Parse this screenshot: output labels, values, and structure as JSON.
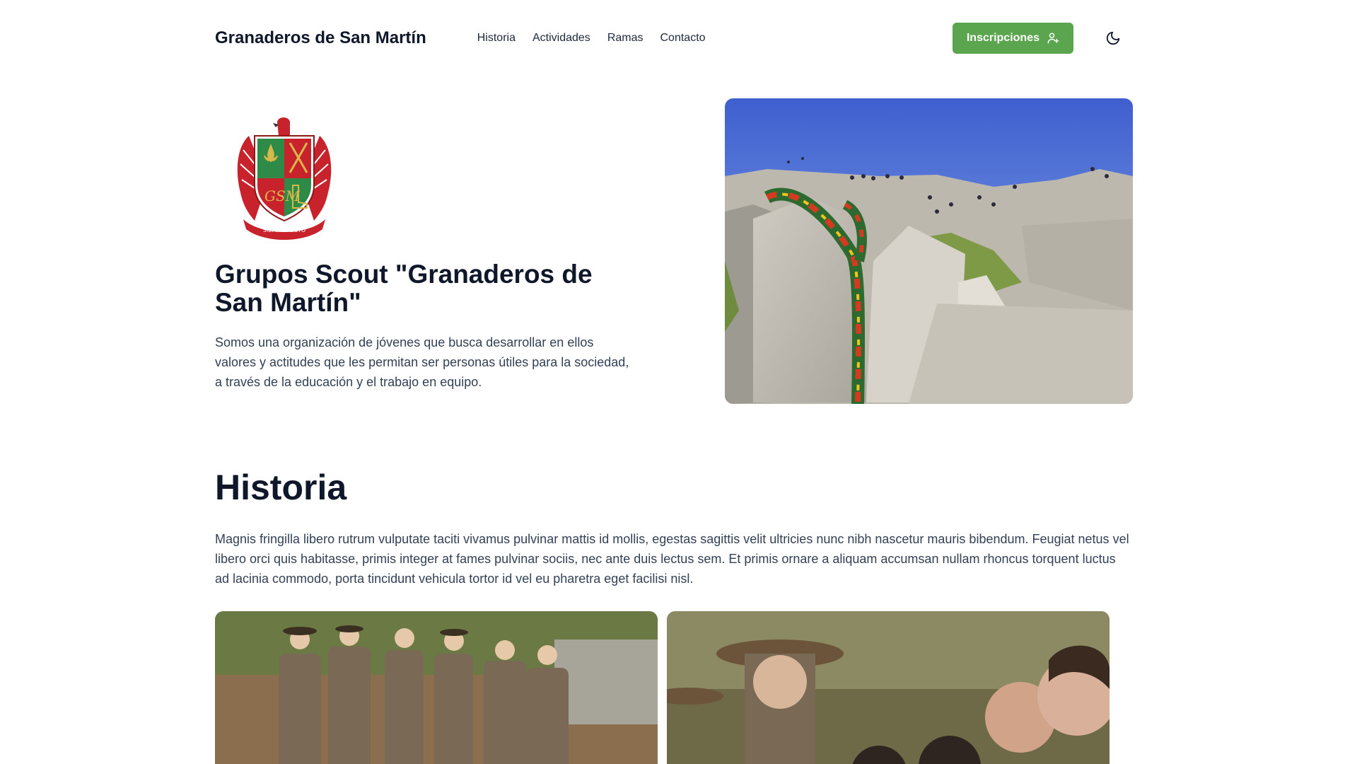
{
  "header": {
    "brand": "Granaderos de San Martín",
    "nav": [
      "Historia",
      "Actividades",
      "Ramas",
      "Contacto"
    ],
    "cta_label": "Inscripciones"
  },
  "hero": {
    "title": "Grupos Scout \"Granaderos de San Martín\"",
    "description": "Somos una organización de jóvenes que busca desarrollar en ellos valores y actitudes que les permitan ser personas útiles para la sociedad, a través de la educación y el trabajo en equipo.",
    "crest_motto": "SIEMPRE LISTO"
  },
  "historia": {
    "title": "Historia",
    "text": "Magnis fringilla libero rutrum vulputate taciti vivamus pulvinar mattis id mollis, egestas sagittis velit ultricies nunc nibh nascetur mauris bibendum. Feugiat netus vel libero orci quis habitasse, primis integer at fames pulvinar sociis, nec ante duis lectus sem. Et primis ornare a aliquam accumsan nullam rhoncus torquent luctus ad lacinia commodo, porta tincidunt vehicula tortor id vel eu pharetra eget facilisi nisl."
  },
  "colors": {
    "cta": "#5aa54e",
    "crest_red": "#c8232c",
    "crest_green": "#2e8b47"
  },
  "icons": {
    "cta_icon": "user-plus-icon",
    "theme_icon": "moon-icon"
  }
}
